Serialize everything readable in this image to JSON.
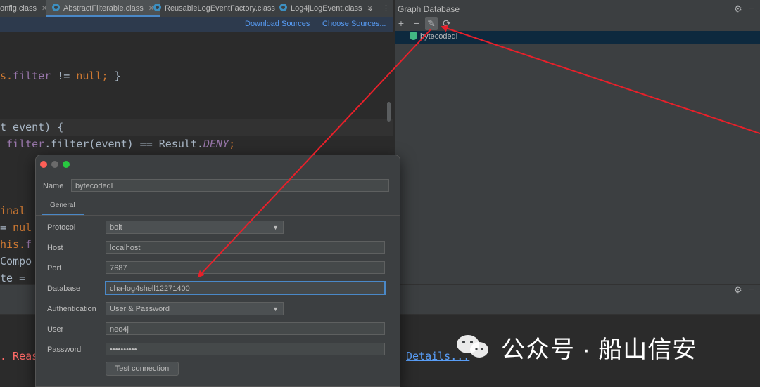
{
  "editor_tabs": [
    {
      "label": "onfig.class",
      "active": false
    },
    {
      "label": "AbstractFilterable.class",
      "active": true
    },
    {
      "label": "ReusableLogEventFactory.class",
      "active": false
    },
    {
      "label": "Log4jLogEvent.class",
      "active": false
    }
  ],
  "tab_overflow": "⌄",
  "tab_menu": "⋮",
  "notice": {
    "download_sources": "Download Sources",
    "choose_sources": "Choose Sources..."
  },
  "code": {
    "l1_a": "s.",
    "l1_b": "filter",
    "l1_c": " != ",
    "l1_d": "null",
    "l1_e": ";",
    "l1_f": " }",
    "l2": "t event) {",
    "l3_a": " ",
    "l3_b": "filter",
    "l3_c": ".filter(event) == Result.",
    "l3_d": "DENY",
    "l3_e": ";",
    "l4": "inal",
    "l5_a": "= ",
    "l5_b": "nul",
    "l6_a": "his.",
    "l6_b": "f",
    "l7": "Compo",
    "l8": "te ="
  },
  "bottom": {
    "reas": ". Reas",
    "details": "Details..."
  },
  "graph_panel": {
    "title": "Graph Database",
    "toolbar": {
      "add": "+",
      "remove": "−",
      "edit": "✎",
      "refresh": "⟳"
    },
    "node": "bytecodedl",
    "gear_icon": "gear-icon",
    "minimize": "−"
  },
  "dialog": {
    "name_label": "Name",
    "name_value": "bytecodedl",
    "tab": "General",
    "fields": {
      "protocol_label": "Protocol",
      "protocol_value": "bolt",
      "host_label": "Host",
      "host_value": "localhost",
      "port_label": "Port",
      "port_value": "7687",
      "database_label": "Database",
      "database_value": "cha-log4shell12271400",
      "auth_label": "Authentication",
      "auth_value": "User & Password",
      "user_label": "User",
      "user_value": "neo4j",
      "password_label": "Password",
      "password_value": "••••••••••"
    },
    "test_button": "Test connection"
  },
  "watermark": {
    "text": "公众号 · 船山信安"
  },
  "colors": {
    "accent": "#4a88c7",
    "arrow": "#e8202a",
    "selection": "#0d293e"
  }
}
